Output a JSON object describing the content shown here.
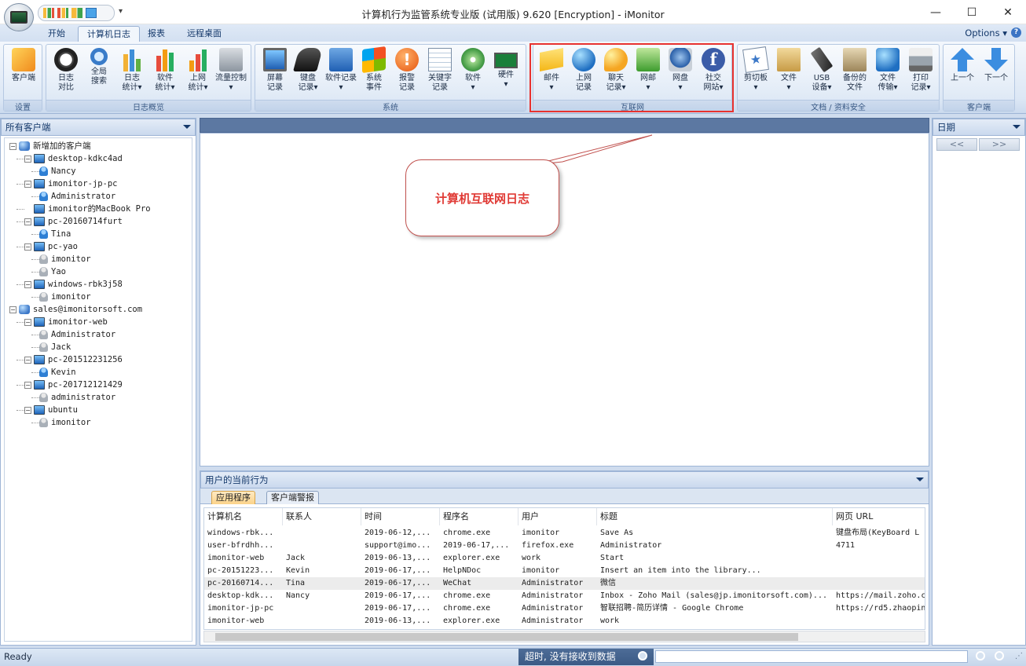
{
  "window": {
    "title": "计算机行为监管系统专业版 (试用版) 9.620 [Encryption] - iMonitor",
    "minimize": "—",
    "maximize": "☐",
    "close": "✕"
  },
  "tabs": [
    "开始",
    "计算机日志",
    "报表",
    "远程桌面"
  ],
  "options_label": "Options",
  "ribbon": {
    "groups": [
      {
        "label": "设置",
        "buttons": [
          "客户端"
        ]
      },
      {
        "label": "日志概览",
        "buttons": [
          "日志\n对比",
          "全局\n搜索",
          "日志\n统计▾",
          "软件\n统计▾",
          "上网\n统计▾",
          "流量控制\n▾"
        ]
      },
      {
        "label": "系统",
        "buttons": [
          "屏幕\n记录",
          "键盘\n记录▾",
          "软件记录\n▾",
          "系统\n事件",
          "报警\n记录",
          "关键字\n记录",
          "软件\n▾",
          "硬件\n▾"
        ]
      },
      {
        "label": "互联网",
        "buttons": [
          "邮件\n▾",
          "上网\n记录",
          "聊天\n记录▾",
          "网邮\n▾",
          "网盘\n▾",
          "社交\n网站▾"
        ]
      },
      {
        "label": "文档 / 资料安全",
        "buttons": [
          "剪切板\n▾",
          "文件\n▾",
          "USB\n设备▾",
          "备份的\n文件",
          "文件\n传输▾",
          "打印\n记录▾"
        ]
      },
      {
        "label": "客户端",
        "buttons": [
          "上一个",
          "下一个"
        ]
      }
    ]
  },
  "left_pane": {
    "title": "所有客户端",
    "tree": [
      {
        "label": "新增加的客户端",
        "type": "grp",
        "level": 0
      },
      {
        "label": "desktop-kdkc4ad",
        "type": "pc",
        "level": 1
      },
      {
        "label": "Nancy",
        "type": "usr",
        "level": 2
      },
      {
        "label": "imonitor-jp-pc",
        "type": "pc",
        "level": 1
      },
      {
        "label": "Administrator",
        "type": "usr",
        "level": 2
      },
      {
        "label": "imonitor的MacBook Pro",
        "type": "pc",
        "level": 1
      },
      {
        "label": "pc-20160714furt",
        "type": "pc",
        "level": 1
      },
      {
        "label": "Tina",
        "type": "usr",
        "level": 2
      },
      {
        "label": "pc-yao",
        "type": "pc",
        "level": 1
      },
      {
        "label": "imonitor",
        "type": "usr-off",
        "level": 2
      },
      {
        "label": "Yao",
        "type": "usr-off",
        "level": 2
      },
      {
        "label": "windows-rbk3j58",
        "type": "pc",
        "level": 1
      },
      {
        "label": "imonitor",
        "type": "usr-off",
        "level": 2
      },
      {
        "label": "sales@imonitorsoft.com",
        "type": "grp",
        "level": 0
      },
      {
        "label": "imonitor-web",
        "type": "pc",
        "level": 1
      },
      {
        "label": "Administrator",
        "type": "usr-off",
        "level": 2
      },
      {
        "label": "Jack",
        "type": "usr-off",
        "level": 2
      },
      {
        "label": "pc-201512231256",
        "type": "pc",
        "level": 1
      },
      {
        "label": "Kevin",
        "type": "usr",
        "level": 2
      },
      {
        "label": "pc-201712121429",
        "type": "pc",
        "level": 1
      },
      {
        "label": "administrator",
        "type": "usr-off",
        "level": 2
      },
      {
        "label": "ubuntu",
        "type": "pc",
        "level": 1
      },
      {
        "label": "imonitor",
        "type": "usr-off",
        "level": 2
      }
    ]
  },
  "right_pane": {
    "title": "日期",
    "prev": "<<",
    "next": ">>"
  },
  "callout": {
    "text": "计算机互联网日志"
  },
  "bottom_pane": {
    "title": "用户的当前行为",
    "tabs": [
      "应用程序",
      "客户端警报"
    ],
    "columns": [
      "计算机名",
      "联系人",
      "时间",
      "程序名",
      "用户",
      "标题",
      "网页 URL"
    ],
    "rows": [
      [
        "windows-rbk...",
        "",
        "2019-06-12,...",
        "chrome.exe",
        "imonitor",
        "Save As",
        "键盘布局(KeyBoard L"
      ],
      [
        "user-bfrdhh...",
        "",
        "support@imo...",
        "2019-06-17,...",
        "firefox.exe",
        "Administrator",
        "4711"
      ],
      [
        "imonitor-web",
        "Jack",
        "2019-06-13,...",
        "explorer.exe",
        "work",
        "Start",
        ""
      ],
      [
        "pc-20151223...",
        "Kevin",
        "2019-06-17,...",
        "HelpNDoc",
        "imonitor",
        "Insert an item into the library...",
        ""
      ],
      [
        "pc-20160714...",
        "Tina",
        "2019-06-17,...",
        "WeChat",
        "Administrator",
        "微信",
        ""
      ],
      [
        "desktop-kdk...",
        "Nancy",
        "2019-06-17,...",
        "chrome.exe",
        "Administrator",
        "Inbox - Zoho Mail (sales@jp.imonitorsoft.com)...",
        "https://mail.zoho.c"
      ],
      [
        "imonitor-jp-pc",
        "",
        "2019-06-17,...",
        "chrome.exe",
        "Administrator",
        "智联招聘-简历详情 - Google Chrome",
        "https://rd5.zhaopin"
      ],
      [
        "imonitor-web",
        "",
        "2019-06-13,...",
        "explorer.exe",
        "Administrator",
        "work",
        ""
      ]
    ]
  },
  "status": {
    "ready": "Ready",
    "message": "超时, 没有接收到数据"
  }
}
